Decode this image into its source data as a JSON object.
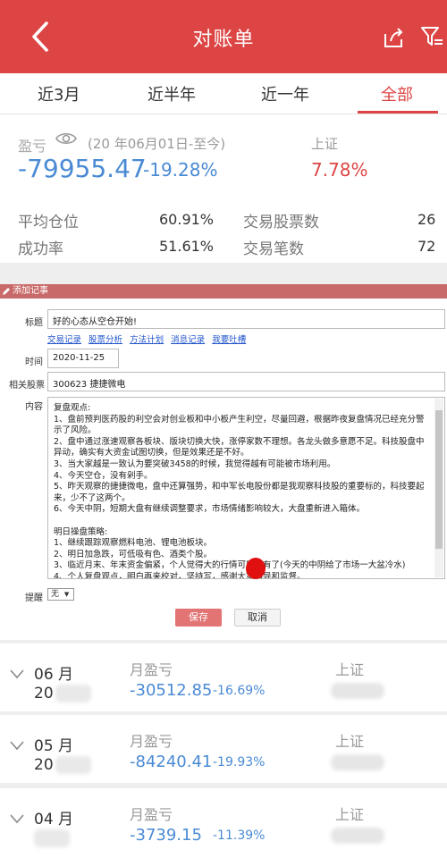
{
  "header": {
    "title": "对账单",
    "back_icon": "chevron-left-icon",
    "share_icon": "share-icon",
    "filter_icon": "filter-icon"
  },
  "tabs": [
    {
      "label": "近3月"
    },
    {
      "label": "近半年"
    },
    {
      "label": "近一年"
    },
    {
      "label": "全部",
      "active": true
    }
  ],
  "summary": {
    "pl_label": "盈亏",
    "range": "(20  年06月01日-至今)",
    "index_label": "上证",
    "total_pl": "-79955.47",
    "total_pct": "-19.28%",
    "index_pct": "7.78%",
    "avg_position_label": "平均仓位",
    "avg_position": "60.91%",
    "stock_count_label": "交易股票数",
    "stock_count": "26",
    "win_rate_label": "成功率",
    "win_rate": "51.61%",
    "trade_count_label": "交易笔数",
    "trade_count": "72"
  },
  "note_form": {
    "header": "添加记事",
    "title_label": "标题",
    "title_value": "好的心态从空仓开始!",
    "links": [
      "交易记录",
      "股票分析",
      "方法计划",
      "消息记录",
      "我要吐槽"
    ],
    "time_label": "时间",
    "time_value": "2020-11-25",
    "stock_label": "相关股票",
    "stock_value": "300623 捷捷微电",
    "content_label": "内容",
    "content": "复盘观点:\n1、盘前预判医药股的利空会对创业板和中小板产生利空，尽量回避，根据昨夜复盘情况已经充分警示了风险。\n2、盘中通过涨速观察各板块、版块切换大快，涨停家数不理想。各龙头做多意愿不足。科技股盘中异动，确实有大资金试图切换，但是效果还是不好。\n3、当大家越是一致认为要突破3458的时候，我觉得越有可能被市场利用。\n4、今天空仓，没有剁手。\n5、昨天观察的捷捷微电，盘中还算强势，和中军长电股份都是我观察科技股的重要标的，科技要起来，少不了这两个。\n6、今天中阴，短期大盘有继续调整要求，市场情绪影响较大，大盘重新进入箱体。\n\n明日操盘策略:\n1、继续跟踪观察燃料电池、锂电池板块。\n2、明日加急跌，可低吸有色、酒类个股。\n3、临近月末、年末资金偏紧，个人觉得大的行情可能没有了(今天的中阴给了市场一大盆冷水)\n4、个人复盘观点，明白再来校对，坚持写，感谢大家指导和监督。",
    "remind_label": "提醒",
    "remind_value": "无",
    "save_label": "保存",
    "cancel_label": "取消"
  },
  "months": [
    {
      "month": "06 月",
      "year": "20",
      "label": "月盈亏",
      "pl": "-30512.85",
      "pct": "-16.69%",
      "index_label": "上证"
    },
    {
      "month": "05 月",
      "year": "20",
      "label": "月盈亏",
      "pl": "-84240.41",
      "pct": "-19.93%",
      "index_label": "上证"
    },
    {
      "month": "04 月",
      "year": "",
      "label": "月盈亏",
      "pl": "-3739.15",
      "pct": "-11.39%",
      "index_label": "上证"
    }
  ]
}
